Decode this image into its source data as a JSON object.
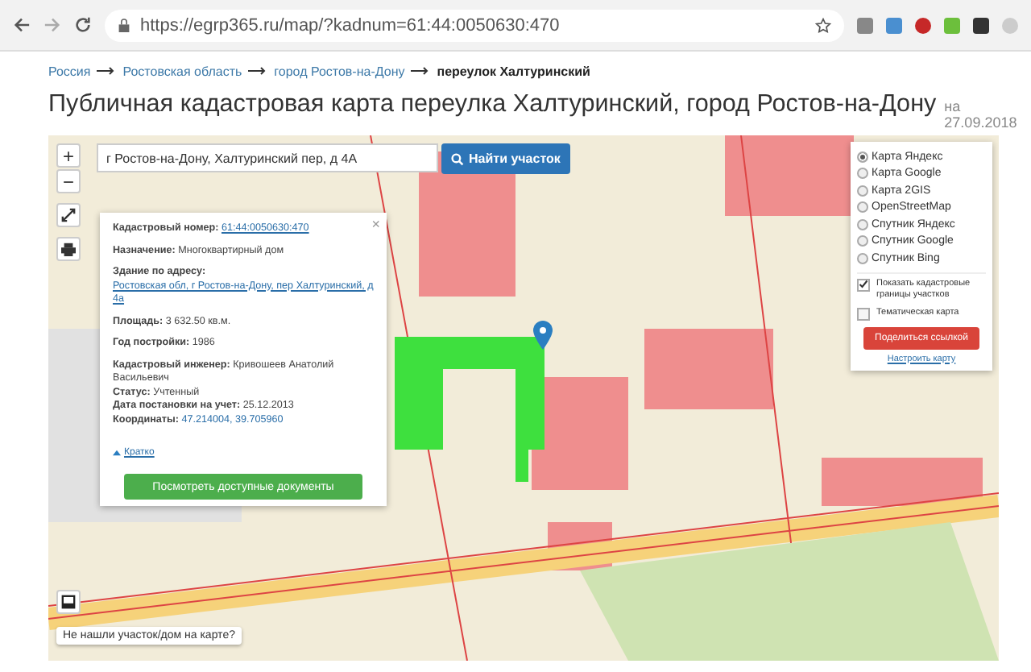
{
  "browser": {
    "url": "https://egrp365.ru/map/?kadnum=61:44:0050630:470"
  },
  "breadcrumb": [
    {
      "text": "Россия",
      "kind": "link"
    },
    {
      "text": "Ростовская область",
      "kind": "link"
    },
    {
      "text": "город Ростов-на-Дону",
      "kind": "link"
    },
    {
      "text": "переулок Халтуринский",
      "kind": "current"
    }
  ],
  "title": "Публичная кадастровая карта переулка Халтуринский, город Ростов-на-Дону",
  "date": "на 27.09.2018",
  "map": {
    "search": {
      "value": "г Ростов-на-Дону, Халтуринский пер, д 4А"
    },
    "search_button": "Найти участок",
    "zoom_in": "+",
    "zoom_out": "−",
    "popup": {
      "close": "×",
      "fields": [
        {
          "label": "Кадастровый номер:",
          "value": "61:44:0050630:470",
          "kind": "link"
        },
        {
          "label": "Назначение:",
          "value": "Многоквартирный дом",
          "kind": "text"
        },
        {
          "label": "Здание по адресу:",
          "value": "Ростовская обл, г Ростов-на-Дону, пер Халтуринский, д 4а",
          "kind": "link"
        },
        {
          "label": "Площадь:",
          "value": "3 632.50 кв.м.",
          "kind": "text"
        },
        {
          "label": "Год постройки:",
          "value": "1986",
          "kind": "text"
        },
        {
          "label": "Кадастровый инженер:",
          "value": "Кривошеев Анатолий Васильевич",
          "kind": "text"
        },
        {
          "label": "Статус:",
          "value": "Учтенный",
          "kind": "text"
        },
        {
          "label": "Дата постановки на учет:",
          "value": "25.12.2013",
          "kind": "text"
        },
        {
          "label": "Координаты:",
          "value": "47.214004, 39.705960",
          "kind": "coords"
        }
      ],
      "collapse_link": "Кратко",
      "docs_button": "Посмотреть доступные документы"
    },
    "layers": {
      "options": [
        {
          "label": "Карта Яндекс",
          "selected": true
        },
        {
          "label": "Карта Google",
          "selected": false
        },
        {
          "label": "Карта 2GIS",
          "selected": false
        },
        {
          "label": "OpenStreetMap",
          "selected": false
        },
        {
          "label": "Спутник Яндекс",
          "selected": false
        },
        {
          "label": "Спутник Google",
          "selected": false
        },
        {
          "label": "Спутник Bing",
          "selected": false
        }
      ],
      "checkboxes": [
        {
          "label": "Показать кадастровые границы участков",
          "checked": true
        },
        {
          "label": "Тематическая карта",
          "checked": false
        }
      ],
      "share_button": "Поделиться ссылкой",
      "settings_link": "Настроить карту"
    },
    "not_found_hint": "Не нашли участок/дом на карте?"
  }
}
